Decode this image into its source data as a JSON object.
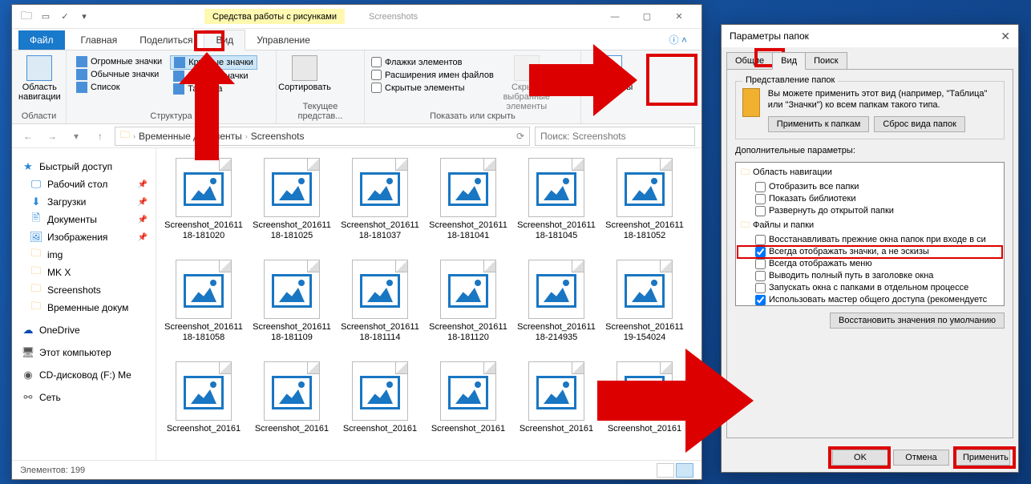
{
  "explorer": {
    "contextTab": "Средства работы с рисунками",
    "windowTitle": "Screenshots",
    "tabs": {
      "file": "Файл",
      "home": "Главная",
      "share": "Поделиться",
      "view": "Вид",
      "manage": "Управление"
    },
    "ribbon": {
      "panes": {
        "nav": "Область навигации",
        "navGroup": "Области",
        "layoutGroup": "Структура",
        "sort": "Сортировать",
        "currentView": "Текущее представ...",
        "showHide": "Показать или скрыть",
        "hideSel": "Скрыть выбранные элементы",
        "options": "Параметры"
      },
      "layouts": {
        "huge": "Огромные значки",
        "large": "Крупные значки",
        "medium": "Обычные значки",
        "small": "Мелкие значки",
        "list": "Список",
        "table": "Таблица"
      },
      "checks": {
        "itemChecks": "Флажки элементов",
        "ext": "Расширения имен файлов",
        "hidden": "Скрытые элементы"
      }
    },
    "path": {
      "seg1": "Временные документы",
      "seg2": "Screenshots"
    },
    "search": "Поиск: Screenshots",
    "nav": {
      "quick": "Быстрый доступ",
      "desktop": "Рабочий стол",
      "downloads": "Загрузки",
      "documents": "Документы",
      "pictures": "Изображения",
      "img": "img",
      "mkx": "MK X",
      "screenshots": "Screenshots",
      "temp": "Временные докум",
      "onedrive": "OneDrive",
      "thispc": "Этот компьютер",
      "cd": "CD-дисковод (F:) Me",
      "network": "Сеть"
    },
    "files": [
      {
        "n": "Screenshot_20161118-181020"
      },
      {
        "n": "Screenshot_20161118-181025"
      },
      {
        "n": "Screenshot_20161118-181037"
      },
      {
        "n": "Screenshot_20161118-181041"
      },
      {
        "n": "Screenshot_20161118-181045"
      },
      {
        "n": "Screenshot_20161118-181052"
      },
      {
        "n": "Screenshot_20161118-181058"
      },
      {
        "n": "Screenshot_20161118-181109"
      },
      {
        "n": "Screenshot_20161118-181114"
      },
      {
        "n": "Screenshot_20161118-181120"
      },
      {
        "n": "Screenshot_20161118-214935"
      },
      {
        "n": "Screenshot_20161119-154024"
      },
      {
        "n": "Screenshot_20161"
      },
      {
        "n": "Screenshot_20161"
      },
      {
        "n": "Screenshot_20161"
      },
      {
        "n": "Screenshot_20161"
      },
      {
        "n": "Screenshot_20161"
      },
      {
        "n": "Screenshot_20161"
      }
    ],
    "status": "Элементов: 199"
  },
  "dialog": {
    "title": "Параметры папок",
    "tabs": {
      "general": "Общие",
      "view": "Вид",
      "search": "Поиск"
    },
    "folderViews": {
      "title": "Представление папок",
      "desc": "Вы можете применить этот вид (например, \"Таблица\" или \"Значки\") ко всем папкам такого типа.",
      "apply": "Применить к папкам",
      "reset": "Сброс вида папок"
    },
    "advanced": {
      "title": "Дополнительные параметры:",
      "navArea": "Область навигации",
      "showAll": "Отобразить все папки",
      "showLibs": "Показать библиотеки",
      "expandOpen": "Развернуть до открытой папки",
      "filesFolders": "Файлы и папки",
      "restoreWin": "Восстанавливать прежние окна папок при входе в си",
      "alwaysIcons": "Всегда отображать значки, а не эскизы",
      "alwaysMenu": "Всегда отображать меню",
      "fullPath": "Выводить полный путь в заголовке окна",
      "separate": "Запускать окна с папками в отдельном процессе",
      "sharing": "Использовать мастер общего доступа (рекомендуетс"
    },
    "restoreDefaults": "Восстановить значения по умолчанию",
    "ok": "OK",
    "cancel": "Отмена",
    "applyBtn": "Применить"
  }
}
